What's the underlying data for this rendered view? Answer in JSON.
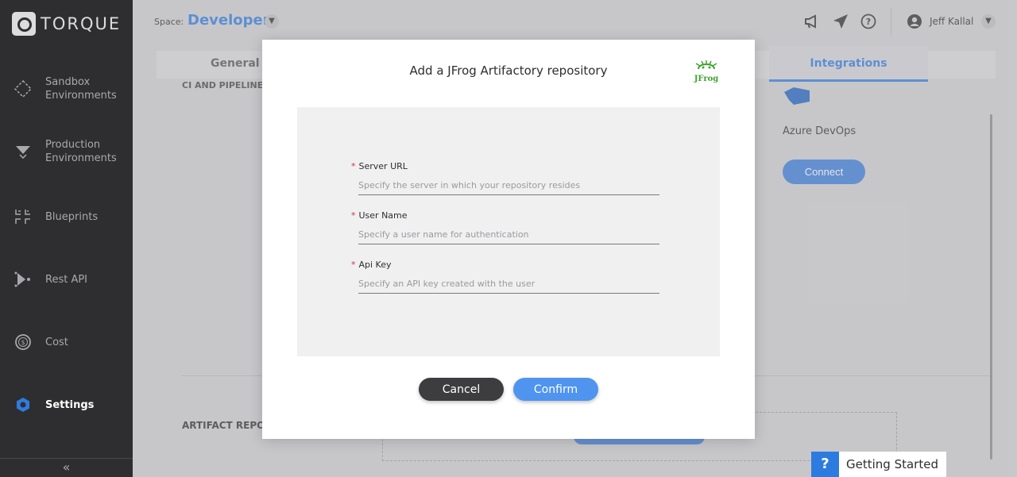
{
  "app": {
    "logo_text": "TORQUE"
  },
  "sidebar": {
    "items": [
      {
        "label": "Sandbox\nEnvironments",
        "icon": "sandbox-icon"
      },
      {
        "label": "Production\nEnvironments",
        "icon": "production-icon"
      },
      {
        "label": "Blueprints",
        "icon": "blueprints-icon"
      },
      {
        "label": "Rest API",
        "icon": "rest-api-icon"
      },
      {
        "label": "Cost",
        "icon": "cost-icon"
      },
      {
        "label": "Settings",
        "icon": "settings-icon",
        "active": true
      }
    ],
    "collapse_label": "«"
  },
  "topbar": {
    "space_label": "Space:",
    "space_value": "Developer",
    "user_name": "Jeff Kallal",
    "icons": [
      "announcement-icon",
      "send-icon",
      "help-icon",
      "user-icon"
    ]
  },
  "background": {
    "tabs": {
      "general": "General",
      "integrations": "Integrations"
    },
    "ci_label": "CI AND PIPELINE",
    "azure_label": "Azure DevOps",
    "connect_label": "Connect",
    "artifact_label": "ARTIFACT REPO"
  },
  "getting_started": {
    "icon": "?",
    "label": "Getting Started"
  },
  "modal": {
    "title": "Add a JFrog Artifactory repository",
    "logo_text": "JFrog",
    "fields": [
      {
        "label": "Server URL",
        "placeholder": "Specify the server in which your repository resides",
        "required": true
      },
      {
        "label": "User Name",
        "placeholder": "Specify a user name for authentication",
        "required": true
      },
      {
        "label": "Api Key",
        "placeholder": "Specify an API key created with the user",
        "required": true
      }
    ],
    "required_mark": "*",
    "cancel_label": "Cancel",
    "confirm_label": "Confirm"
  },
  "colors": {
    "accent": "#2e7be0",
    "sidebar_bg": "#2e2e30",
    "confirm": "#4f94ef",
    "cancel": "#3d3d40",
    "required": "#d9303a",
    "jfrog_green": "#40a22f"
  }
}
